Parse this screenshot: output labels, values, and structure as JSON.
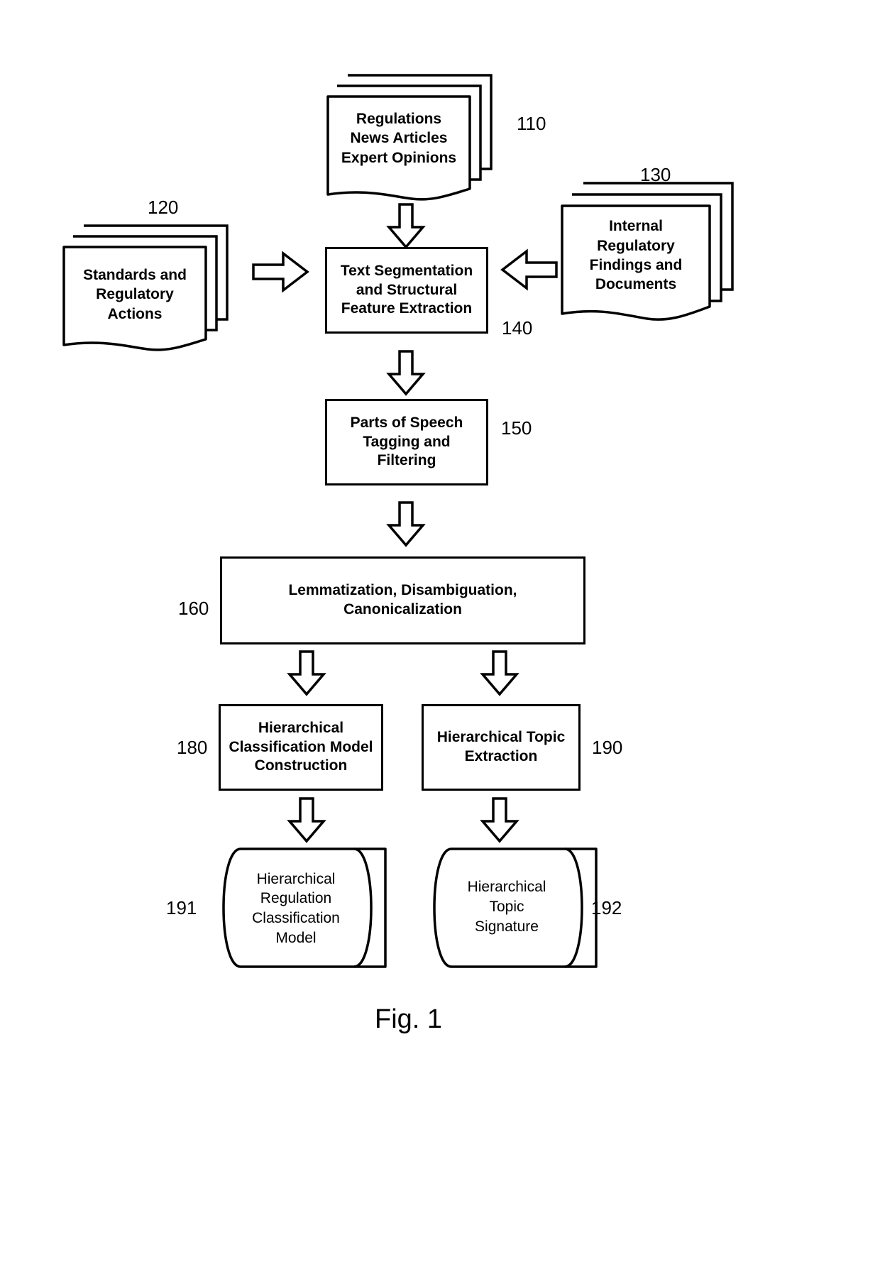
{
  "figure": {
    "caption": "Fig. 1"
  },
  "sources": [
    {
      "id": "regulations-news-expert",
      "ref": "110",
      "lines": [
        "Regulations",
        "News Articles",
        "Expert Opinions"
      ],
      "text": "Regulations\nNews Articles\nExpert Opinions"
    },
    {
      "id": "standards-regulatory-actions",
      "ref": "120",
      "lines": [
        "Standards and",
        "Regulatory",
        "Actions"
      ],
      "text": "Standards and\nRegulatory\nActions"
    },
    {
      "id": "internal-regulatory-findings",
      "ref": "130",
      "lines": [
        "Internal",
        "Regulatory",
        "Findings and",
        "Documents"
      ],
      "text": "Internal\nRegulatory\nFindings and\nDocuments"
    }
  ],
  "processes": [
    {
      "id": "text-segmentation",
      "ref": "140",
      "lines": [
        "Text Segmentation",
        "and Structural",
        "Feature Extraction"
      ],
      "text": "Text Segmentation\nand Structural\nFeature Extraction"
    },
    {
      "id": "pos-tagging",
      "ref": "150",
      "lines": [
        "Parts of Speech",
        "Tagging and",
        "Filtering"
      ],
      "text": "Parts of Speech\nTagging and\nFiltering"
    },
    {
      "id": "lemmatization",
      "ref": "160",
      "lines": [
        "Lemmatization, Disambiguation,",
        "Canonicalization"
      ],
      "text": "Lemmatization, Disambiguation,\nCanonicalization"
    },
    {
      "id": "hierarchical-classification-model-construction",
      "ref": "180",
      "lines": [
        "Hierarchical",
        "Classification Model",
        "Construction"
      ],
      "text": "Hierarchical\nClassification Model\nConstruction"
    },
    {
      "id": "hierarchical-topic-extraction",
      "ref": "190",
      "lines": [
        "Hierarchical Topic",
        "Extraction"
      ],
      "text": "Hierarchical Topic\nExtraction"
    }
  ],
  "datastores": [
    {
      "id": "hierarchical-regulation-classification-model",
      "ref": "191",
      "lines": [
        "Hierarchical",
        "Regulation",
        "Classification",
        "Model"
      ],
      "text": "Hierarchical\nRegulation\nClassification\nModel"
    },
    {
      "id": "hierarchical-topic-signature",
      "ref": "192",
      "lines": [
        "Hierarchical",
        "Topic",
        "Signature"
      ],
      "text": "Hierarchical\nTopic\nSignature"
    }
  ],
  "flows": [
    {
      "id": "flow-110-to-140",
      "direction": "down",
      "from": "110",
      "to": "140"
    },
    {
      "id": "flow-120-to-140",
      "direction": "right",
      "from": "120",
      "to": "140"
    },
    {
      "id": "flow-130-to-140",
      "direction": "left",
      "from": "130",
      "to": "140"
    },
    {
      "id": "flow-140-to-150",
      "direction": "down",
      "from": "140",
      "to": "150"
    },
    {
      "id": "flow-150-to-160",
      "direction": "down",
      "from": "150",
      "to": "160"
    },
    {
      "id": "flow-160-to-180",
      "direction": "down",
      "from": "160",
      "to": "180"
    },
    {
      "id": "flow-160-to-190",
      "direction": "down",
      "from": "160",
      "to": "190"
    },
    {
      "id": "flow-180-to-191",
      "direction": "down",
      "from": "180",
      "to": "191"
    },
    {
      "id": "flow-190-to-192",
      "direction": "down",
      "from": "190",
      "to": "192"
    }
  ],
  "colors": {
    "stroke": "#000000",
    "fill": "#ffffff",
    "text": "#000000"
  }
}
